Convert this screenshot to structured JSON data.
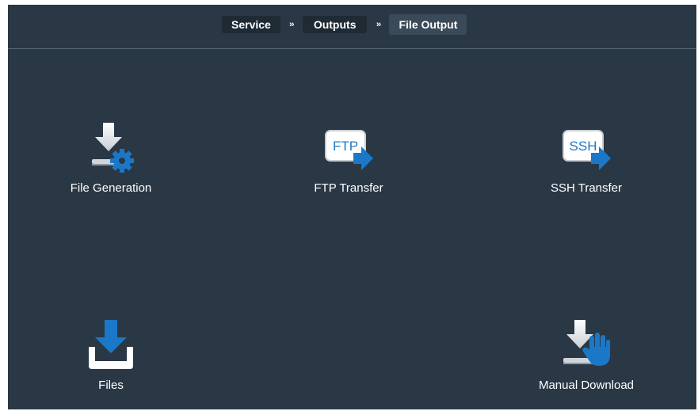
{
  "breadcrumb": {
    "items": [
      {
        "label": "Service"
      },
      {
        "label": "Outputs"
      },
      {
        "label": "File Output"
      }
    ],
    "separator": "››"
  },
  "tiles": [
    {
      "label": "File Generation",
      "icon": "download-gear-icon"
    },
    {
      "label": "FTP Transfer",
      "icon": "ftp-transfer-icon",
      "badge": "FTP"
    },
    {
      "label": "SSH Transfer",
      "icon": "ssh-transfer-icon",
      "badge": "SSH"
    },
    {
      "label": "Files",
      "icon": "tray-download-icon"
    },
    {
      "label": "Manual Download",
      "icon": "download-hand-icon"
    }
  ],
  "colors": {
    "background": "#2a3845",
    "crumb": "#1e2a34",
    "crumb_current": "#3b4a58",
    "accent": "#1b78c8"
  }
}
